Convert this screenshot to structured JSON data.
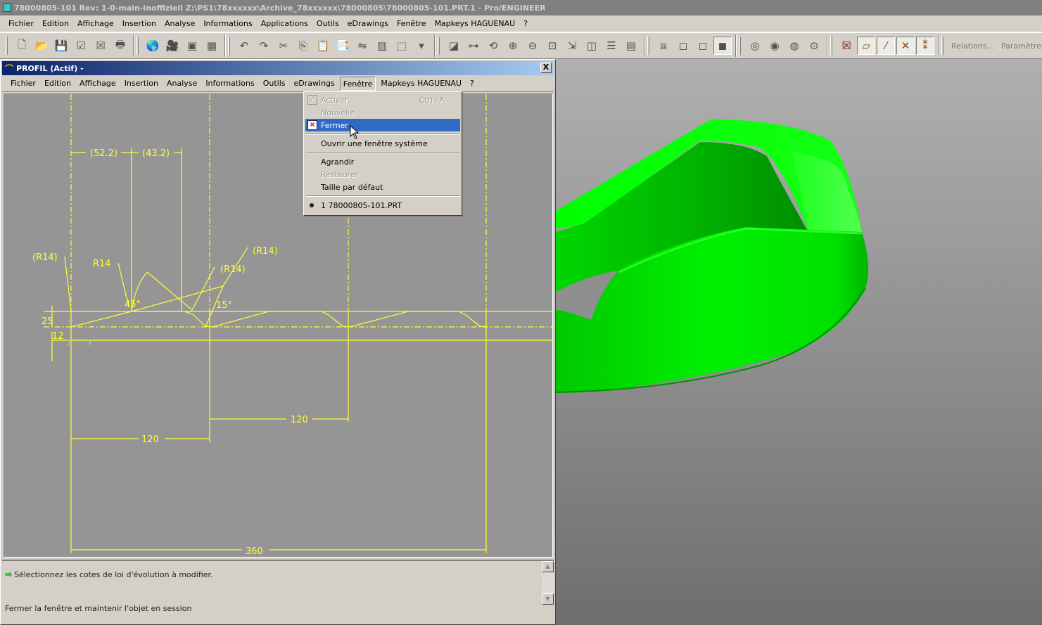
{
  "app": {
    "title": "78000805-101 Rev: 1-0-main-inoffiziell Z:\\PS1\\78xxxxxx\\Archive_78xxxxxx\\78000805\\78000805-101.PRT.1 - Pro/ENGINEER"
  },
  "main_menu": [
    {
      "label": "Fichier"
    },
    {
      "label": "Edition"
    },
    {
      "label": "Affichage"
    },
    {
      "label": "Insertion"
    },
    {
      "label": "Analyse"
    },
    {
      "label": "Informations"
    },
    {
      "label": "Applications"
    },
    {
      "label": "Outils"
    },
    {
      "label": "eDrawings"
    },
    {
      "label": "Fenêtre"
    },
    {
      "label": "Mapkeys HAGUENAU"
    },
    {
      "label": "?"
    }
  ],
  "toolbar": {
    "groups": [
      [
        {
          "name": "new-file-icon",
          "glyph": "🗋"
        },
        {
          "name": "open-folder-icon",
          "glyph": "📂"
        },
        {
          "name": "save-icon",
          "glyph": "💾"
        },
        {
          "name": "activate-window-icon",
          "glyph": "☑"
        },
        {
          "name": "close-window-icon",
          "glyph": "☒"
        },
        {
          "name": "print-icon",
          "glyph": "🖶"
        }
      ],
      [
        {
          "name": "globe-icon",
          "glyph": "🌎"
        },
        {
          "name": "camera-icon",
          "glyph": "🎥"
        },
        {
          "name": "model-display-icon",
          "glyph": "▣"
        },
        {
          "name": "regenerate-icon",
          "glyph": "▦"
        }
      ],
      [
        {
          "name": "undo-icon",
          "glyph": "↶"
        },
        {
          "name": "redo-icon",
          "glyph": "↷"
        },
        {
          "name": "cut-icon",
          "glyph": "✂"
        },
        {
          "name": "copy-icon",
          "glyph": "⎘"
        },
        {
          "name": "paste-icon",
          "glyph": "📋"
        },
        {
          "name": "paste-special-icon",
          "glyph": "📑"
        },
        {
          "name": "mirror-icon",
          "glyph": "⇋"
        },
        {
          "name": "pattern-icon",
          "glyph": "▥"
        },
        {
          "name": "selection-box-icon",
          "glyph": "⬚"
        },
        {
          "name": "dropdown-arrow-icon",
          "glyph": "▾"
        }
      ],
      [
        {
          "name": "repaint-icon",
          "glyph": "◪"
        },
        {
          "name": "spin-center-icon",
          "glyph": "⊶"
        },
        {
          "name": "orient-icon",
          "glyph": "⟲"
        },
        {
          "name": "zoom-in-icon",
          "glyph": "⊕"
        },
        {
          "name": "zoom-out-icon",
          "glyph": "⊖"
        },
        {
          "name": "refit-icon",
          "glyph": "⊡"
        },
        {
          "name": "reorient-icon",
          "glyph": "⇲"
        },
        {
          "name": "saved-views-icon",
          "glyph": "◫"
        },
        {
          "name": "layers-icon",
          "glyph": "☰"
        },
        {
          "name": "view-manager-icon",
          "glyph": "▤"
        }
      ],
      [
        {
          "name": "wireframe-icon",
          "glyph": "⧈"
        },
        {
          "name": "hidden-line-icon",
          "glyph": "◻"
        },
        {
          "name": "no-hidden-icon",
          "glyph": "◻"
        },
        {
          "name": "shading-icon",
          "glyph": "◼",
          "pressed": true
        }
      ],
      [
        {
          "name": "hide-dims-icon",
          "glyph": "◎"
        },
        {
          "name": "show-dims-icon",
          "glyph": "◉"
        },
        {
          "name": "show-constraints-icon",
          "glyph": "◍"
        },
        {
          "name": "show-vertices-icon",
          "glyph": "⊙"
        }
      ],
      [
        {
          "name": "datum-display-off-icon",
          "glyph": "☒",
          "color": "#8b0000"
        },
        {
          "name": "datum-planes-icon",
          "glyph": "▱",
          "color": "#8b4513",
          "toggled": true
        },
        {
          "name": "datum-axes-icon",
          "glyph": "⁄",
          "color": "#8b4513",
          "toggled": true
        },
        {
          "name": "coordinate-systems-icon",
          "glyph": "✕",
          "color": "#8b4513",
          "toggled": true
        },
        {
          "name": "datum-points-icon",
          "glyph": "⁑",
          "color": "#8b4513",
          "toggled": true
        }
      ]
    ],
    "relations_label": "Relations...",
    "parameters_label": "Paramètres...",
    "help_label": "?"
  },
  "sketch_window": {
    "title": "PROFIL (Actif) -",
    "close_label": "X",
    "menu": [
      {
        "label": "Fichier"
      },
      {
        "label": "Edition"
      },
      {
        "label": "Affichage"
      },
      {
        "label": "Insertion"
      },
      {
        "label": "Analyse"
      },
      {
        "label": "Informations"
      },
      {
        "label": "Outils"
      },
      {
        "label": "eDrawings"
      },
      {
        "label": "Fenêtre",
        "open": true
      },
      {
        "label": "Mapkeys HAGUENAU"
      },
      {
        "label": "?"
      }
    ],
    "dimensions": {
      "d1": "(52.2)",
      "d2": "(43.2)",
      "r1": "(R14)",
      "r2": "R14",
      "r3": "(R14)",
      "r4": "(R14)",
      "a1": "45°",
      "a2": "15°",
      "h1": "25",
      "h2": "12",
      "l1": "120",
      "l2": "120",
      "total": "360",
      "axis_y": "Y",
      "axis_z": "Z",
      "axis_x": "X"
    },
    "message": "Sélectionnez les cotes de loi d'évolution à modifier.",
    "status": "Fermer la fenêtre et maintenir l'objet en session",
    "sketch_color": "#ffff33",
    "canvas_bg": "#959595"
  },
  "window_menu": {
    "items": [
      {
        "label": "Activer",
        "shortcut": "Ctrl+A",
        "disabled": true,
        "icon": "activate-window-icon"
      },
      {
        "label": "Nouvelle",
        "disabled": true
      },
      {
        "label": "Fermer",
        "highlight": true,
        "icon": "close-window-icon"
      },
      {
        "sep": true
      },
      {
        "label": "Ouvrir une fenêtre système"
      },
      {
        "sep": true
      },
      {
        "label": "Agrandir"
      },
      {
        "label": "Restaurer",
        "disabled": true
      },
      {
        "label": "Taille par défaut"
      },
      {
        "sep": true
      },
      {
        "label": "1 78000805-101.PRT",
        "bullet": true
      }
    ]
  },
  "model": {
    "color": "#00ff00",
    "shade": "#00b800"
  }
}
